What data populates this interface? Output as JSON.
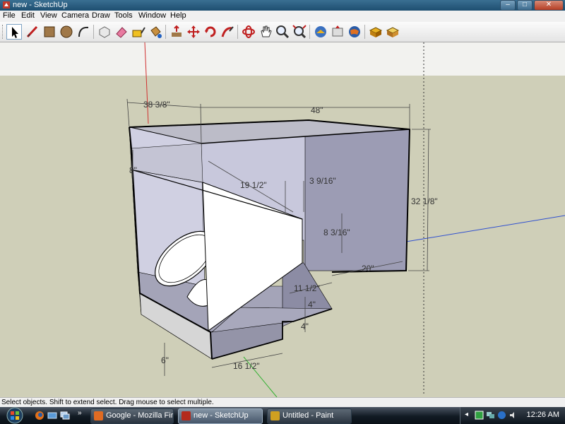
{
  "window": {
    "title": "new - SketchUp"
  },
  "menu": [
    "File",
    "Edit",
    "View",
    "Camera",
    "Draw",
    "Tools",
    "Window",
    "Help"
  ],
  "tools": [
    {
      "name": "select-tool-icon"
    },
    {
      "name": "line-tool-icon"
    },
    {
      "name": "rectangle-tool-icon"
    },
    {
      "name": "circle-tool-icon"
    },
    {
      "name": "arc-tool-icon"
    },
    {
      "name": "make-component-icon"
    },
    {
      "name": "eraser-tool-icon"
    },
    {
      "name": "tape-measure-icon"
    },
    {
      "name": "paint-bucket-icon"
    },
    {
      "name": "push-pull-icon"
    },
    {
      "name": "move-tool-icon"
    },
    {
      "name": "rotate-tool-icon"
    },
    {
      "name": "follow-me-icon"
    },
    {
      "name": "orbit-tool-icon"
    },
    {
      "name": "pan-tool-icon"
    },
    {
      "name": "zoom-tool-icon"
    },
    {
      "name": "zoom-extents-icon"
    },
    {
      "name": "get-models-icon"
    },
    {
      "name": "share-model-icon"
    },
    {
      "name": "google-earth-icon"
    },
    {
      "name": "components-icon"
    },
    {
      "name": "materials-icon"
    }
  ],
  "dimensions": {
    "d1": "38 3/8\"",
    "d2": "48\"",
    "d3": "8\"",
    "d4": "19 1/2\"",
    "d5": "3 9/16\"",
    "d6": "32 1/8\"",
    "d7": "8 3/16\"",
    "d8": "20\"",
    "d9": "11 1/2\"",
    "d10": "4\"",
    "d11": "4\"",
    "d12": "6\"",
    "d13": "16 1/2\""
  },
  "status": "Select objects. Shift to extend select. Drag mouse to select multiple.",
  "taskbar": {
    "tasks": [
      {
        "label": "Google - Mozilla Fir...",
        "color": "#e06b22"
      },
      {
        "label": "new - SketchUp",
        "color": "#b32a1d"
      },
      {
        "label": "Untitled - Paint",
        "color": "#d0a020"
      }
    ],
    "clock": "12:26 AM"
  },
  "colors": {
    "sky": "#f2f2ef",
    "ground": "#cfcfb8",
    "face_light": "#c8c8dc",
    "face_dark": "#8c8ca4",
    "horn_white": "#ffffff"
  }
}
